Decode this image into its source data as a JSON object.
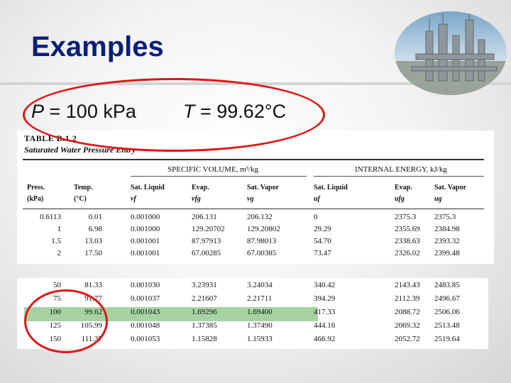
{
  "slide": {
    "title": "Examples",
    "logo_icon": "refinery-photo"
  },
  "equations": {
    "p_var": "P",
    "p_rest": " = 100 kPa",
    "t_var": "T",
    "t_rest": " = 99.62°C"
  },
  "table": {
    "caption": "TABLE B.1.2",
    "subtitle": "Saturated Water Pressure Entry",
    "group_specific_volume": "SPECIFIC VOLUME, m³/kg",
    "group_internal_energy": "INTERNAL ENERGY, kJ/kg",
    "headers": [
      {
        "l1": "Press.",
        "l2": "(kPa)"
      },
      {
        "l1": "Temp.",
        "l2": "(°C)"
      },
      {
        "l1": "Sat. Liquid",
        "l2": "vf"
      },
      {
        "l1": "Evap.",
        "l2": "vfg"
      },
      {
        "l1": "Sat. Vapor",
        "l2": "vg"
      },
      {
        "l1": "Sat. Liquid",
        "l2": "uf"
      },
      {
        "l1": "Evap.",
        "l2": "ufg"
      },
      {
        "l1": "Sat. Vapor",
        "l2": "ug"
      }
    ],
    "rows_top": [
      [
        "0.6113",
        "0.01",
        "0.001000",
        "206.131",
        "206.132",
        "0",
        "2375.3",
        "2375.3"
      ],
      [
        "1",
        "6.98",
        "0.001000",
        "129.20702",
        "129.20802",
        "29.29",
        "2355.69",
        "2384.98"
      ],
      [
        "1.5",
        "13.03",
        "0.001001",
        "87.97913",
        "87.98013",
        "54.70",
        "2338.63",
        "2393.32"
      ],
      [
        "2",
        "17.50",
        "0.001001",
        "67.00285",
        "67.00385",
        "73.47",
        "2326.02",
        "2399.48"
      ]
    ],
    "rows_bottom": [
      [
        "50",
        "81.33",
        "0.001030",
        "3.23931",
        "3.24034",
        "340.42",
        "2143.43",
        "2483.85"
      ],
      [
        "75",
        "91.77",
        "0.001037",
        "2.21607",
        "2.21711",
        "394.29",
        "2112.39",
        "2496.67"
      ],
      [
        "100",
        "99.62",
        "0.001043",
        "1.69296",
        "1.69400",
        "417.33",
        "2088.72",
        "2506.06"
      ],
      [
        "125",
        "105.99",
        "0.001048",
        "1.37385",
        "1.37490",
        "444.16",
        "2069.32",
        "2513.48"
      ],
      [
        "150",
        "111.37",
        "0.001053",
        "1.15828",
        "1.15933",
        "466.92",
        "2052.72",
        "2519.64"
      ]
    ]
  },
  "annotations": {
    "color": "#e01515",
    "highlight_color": "#a7d3a3"
  }
}
